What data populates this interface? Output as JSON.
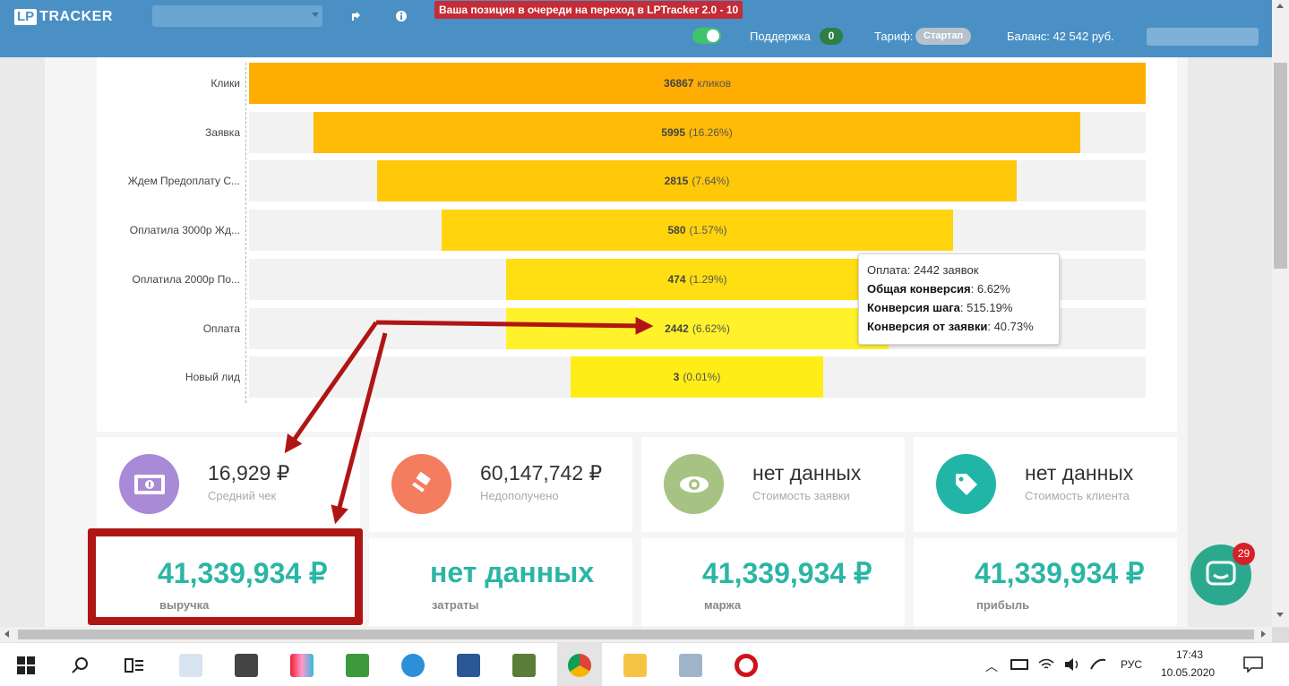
{
  "header": {
    "logo_lp": "LP",
    "logo_tracker": "TRACKER",
    "queue_banner": "Ваша позиция в очереди на переход в LPTracker 2.0 - 10",
    "support_label": "Поддержка",
    "support_count": "0",
    "tariff_label": "Тариф:",
    "tariff_value": "Стартап",
    "balance": "Баланс: 42 542 руб."
  },
  "funnel": {
    "rows": [
      {
        "label": "Клики",
        "value": "36867",
        "suffix": "кликов",
        "fraction": 1.0,
        "offset": 0.0,
        "color": "#ffad03"
      },
      {
        "label": "Заявка",
        "value": "5995",
        "suffix": "(16.26%)",
        "fraction": 0.855,
        "offset": 0.072,
        "color": "#ffbb05"
      },
      {
        "label": "Ждем Предоплату С...",
        "value": "2815",
        "suffix": "(7.64%)",
        "fraction": 0.713,
        "offset": 0.143,
        "color": "#ffc808"
      },
      {
        "label": "Оплатила 3000р Жд...",
        "value": "580",
        "suffix": "(1.57%)",
        "fraction": 0.57,
        "offset": 0.215,
        "color": "#ffd40d"
      },
      {
        "label": "Оплатила 2000р По...",
        "value": "474",
        "suffix": "(1.29%)",
        "fraction": 0.427,
        "offset": 0.287,
        "color": "#ffdf12"
      },
      {
        "label": "Оплата",
        "value": "2442",
        "suffix": "(6.62%)",
        "fraction": 0.427,
        "offset": 0.287,
        "color": "#fff22a"
      },
      {
        "label": "Новый лид",
        "value": "3",
        "suffix": "(0.01%)",
        "fraction": 0.282,
        "offset": 0.359,
        "color": "#ffed18"
      }
    ]
  },
  "tooltip": {
    "line1": "Оплата: 2442 заявок",
    "l2_label": "Общая конверсия",
    "l2_value": ": 6.62%",
    "l3_label": "Конверсия шага",
    "l3_value": ": 515.19%",
    "l4_label": "Конверсия от заявки",
    "l4_value": ": 40.73%"
  },
  "stats": [
    {
      "value": "16,929 ₽",
      "label": "Средний чек",
      "color": "#a98ad6"
    },
    {
      "value": "60,147,742 ₽",
      "label": "Недополучено",
      "color": "#f47c5f"
    },
    {
      "value": "нет данных",
      "label": "Стоимость заявки",
      "color": "#a7c384"
    },
    {
      "value": "нет данных",
      "label": "Стоимость клиента",
      "color": "#21b5a8"
    }
  ],
  "totals": [
    {
      "value": "41,339,934 ₽",
      "label": "выручка"
    },
    {
      "value": "нет данных",
      "label": "затраты"
    },
    {
      "value": "41,339,934 ₽",
      "label": "маржа"
    },
    {
      "value": "41,339,934 ₽",
      "label": "прибыль"
    }
  ],
  "chat": {
    "badge": "29"
  },
  "taskbar": {
    "lang": "РУС",
    "time": "17:43",
    "date": "10.05.2020"
  }
}
